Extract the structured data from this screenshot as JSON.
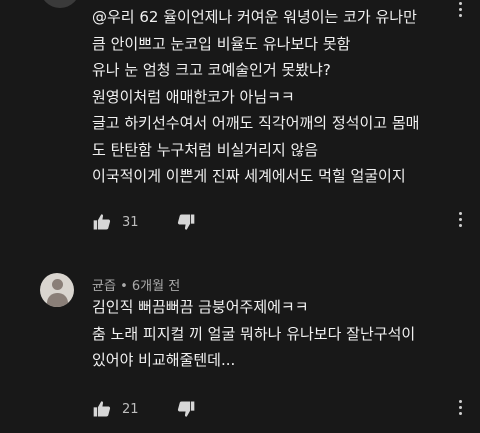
{
  "comment1": {
    "lines": [
      "@우리 62 율이언제나 커여운 워녕이는 코가 유나만",
      "큼 안이쁘고 눈코입 비율도 유나보다 못함",
      "유나 눈 엄청 크고 코예술인거 못봤냐?",
      "원영이처럼 애매한코가 아님ㅋㅋ",
      "글고 하키선수여서 어깨도 직각어깨의 정석이고 몸매",
      "도 탄탄함 누구처럼 비실거리지 않음",
      "이국적이게 이쁜게 진짜 세계에서도 먹힐 얼굴이지"
    ],
    "like_count": "31"
  },
  "comment2": {
    "author": "균즙",
    "separator": "•",
    "time": "6개월 전",
    "lines": [
      "김인직 뻐끔뻐끔 금붕어주제에ㅋㅋ",
      "춤 노래 피지컬 끼 얼굴 뭐하나 유나보다 잘난구석이",
      "있어야 비교해줄텐데..."
    ],
    "like_count": "21"
  },
  "icons": {
    "like": "thumbs-up-icon",
    "dislike": "thumbs-down-icon",
    "more": "more-vert-icon"
  },
  "colors": {
    "background": "#181818",
    "text": "#f1f1f1",
    "meta": "#aaaaaa"
  }
}
